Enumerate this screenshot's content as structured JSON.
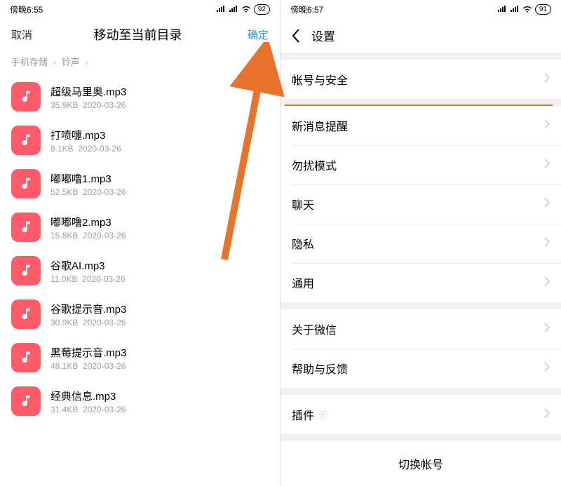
{
  "left": {
    "status": {
      "time": "傍晚6:55",
      "battery": "92"
    },
    "header": {
      "cancel": "取消",
      "title": "移动至当前目录",
      "confirm": "确定"
    },
    "breadcrumb": {
      "part1": "手机存储",
      "part2": "铃声"
    },
    "files": [
      {
        "name": "超级马里奥.mp3",
        "size": "35.9KB",
        "date": "2020-03-26"
      },
      {
        "name": "打喷嚏.mp3",
        "size": "8.1KB",
        "date": "2020-03-26"
      },
      {
        "name": "嘟嘟噜1.mp3",
        "size": "52.5KB",
        "date": "2020-03-26"
      },
      {
        "name": "嘟嘟噜2.mp3",
        "size": "15.8KB",
        "date": "2020-03-26"
      },
      {
        "name": "谷歌AI.mp3",
        "size": "11.0KB",
        "date": "2020-03-26"
      },
      {
        "name": "谷歌提示音.mp3",
        "size": "30.9KB",
        "date": "2020-03-26"
      },
      {
        "name": "黑莓提示音.mp3",
        "size": "48.1KB",
        "date": "2020-03-26"
      },
      {
        "name": "经典信息.mp3",
        "size": "31.4KB",
        "date": "2020-03-26"
      }
    ]
  },
  "right": {
    "status": {
      "time": "傍晚6:57",
      "battery": "91"
    },
    "header": {
      "title": "设置"
    },
    "group1": [
      "帐号与安全"
    ],
    "group2": [
      "新消息提醒",
      "勿扰模式",
      "聊天",
      "隐私",
      "通用"
    ],
    "group3": [
      "关于微信",
      "帮助与反馈"
    ],
    "group4": [
      "插件"
    ],
    "switch": "切换帐号"
  }
}
